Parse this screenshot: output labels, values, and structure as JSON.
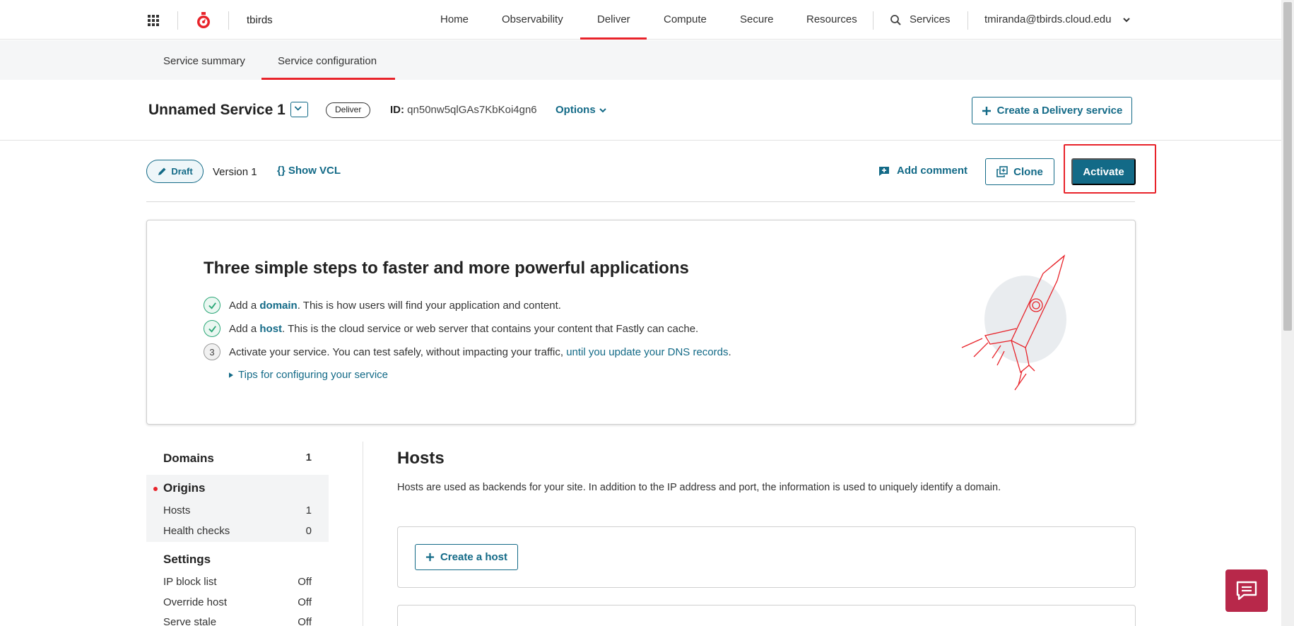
{
  "topnav": {
    "brand": "tbirds",
    "items": [
      "Home",
      "Observability",
      "Deliver",
      "Compute",
      "Secure",
      "Resources"
    ],
    "active_item": "Deliver",
    "services_label": "Services",
    "user_email": "tmiranda@tbirds.cloud.edu"
  },
  "subnav": {
    "tabs": [
      "Service summary",
      "Service configuration"
    ],
    "active_tab": "Service configuration"
  },
  "service": {
    "name": "Unnamed Service 1",
    "type_badge": "Deliver",
    "id_label": "ID:",
    "id_value": "qn50nw5qlGAs7KbKoi4gn6",
    "options_label": "Options",
    "create_button": "Create a Delivery service"
  },
  "version_bar": {
    "status": "Draft",
    "version": "Version 1",
    "show_vcl": "Show VCL",
    "add_comment": "Add comment",
    "clone": "Clone",
    "activate": "Activate"
  },
  "onboarding": {
    "title": "Three simple steps to faster and more powerful applications",
    "step1_pre": "Add a ",
    "step1_link": "domain",
    "step1_post": ". This is how users will find your application and content.",
    "step2_pre": "Add a ",
    "step2_link": "host",
    "step2_post": ". This is the cloud service or web server that contains your content that Fastly can cache.",
    "step3_num": "3",
    "step3_pre": "Activate your service. You can test safely, without impacting your traffic, ",
    "step3_link": "until you update your DNS records",
    "step3_post": ".",
    "tips": "Tips for configuring your service"
  },
  "sidebar": {
    "domains_label": "Domains",
    "domains_count": "1",
    "origins_label": "Origins",
    "hosts_label": "Hosts",
    "hosts_count": "1",
    "health_label": "Health checks",
    "health_count": "0",
    "settings_label": "Settings",
    "ipblock_label": "IP block list",
    "ipblock_value": "Off",
    "override_label": "Override host",
    "override_value": "Off",
    "stale_label": "Serve stale",
    "stale_value": "Off"
  },
  "hosts": {
    "title": "Hosts",
    "description": "Hosts are used as backends for your site. In addition to the IP address and port, the information is used to uniquely identify a domain.",
    "create_button": "Create a host"
  },
  "colors": {
    "accent": "#136a87",
    "brand_red": "#e8232a",
    "success": "#2aa777",
    "chat": "#b8284a"
  }
}
